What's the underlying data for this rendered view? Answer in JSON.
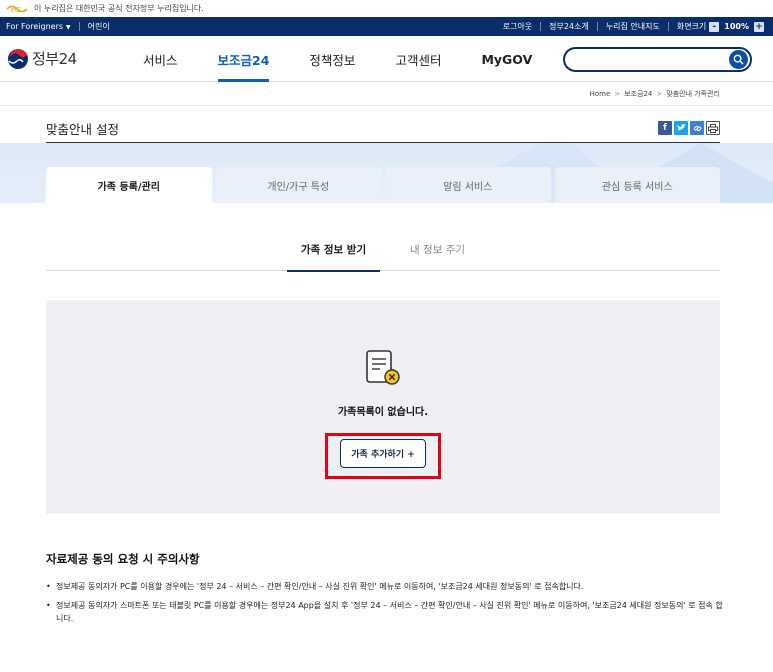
{
  "notice": {
    "text": "이 누리집은 대한민국 공식 전자정부 누리집입니다."
  },
  "utility": {
    "for_foreigners": "For Foreigners",
    "kids": "어린이",
    "logout": "로그아웃",
    "about": "정부24소개",
    "sitemap": "누리집 안내지도",
    "zoom_label": "화면크기",
    "zoom_minus": "-",
    "zoom_value": "100%",
    "zoom_plus": "+"
  },
  "header": {
    "brand": "정부24",
    "nav": [
      {
        "label": "서비스"
      },
      {
        "label": "보조금24"
      },
      {
        "label": "정책정보"
      },
      {
        "label": "고객센터"
      },
      {
        "label": "MyGOV"
      }
    ],
    "search_placeholder": ""
  },
  "breadcrumb": [
    "Home",
    "보조금24",
    "맞춤안내 가족관리"
  ],
  "page": {
    "title": "맞춤안내 설정"
  },
  "tabs": [
    {
      "label": "가족 등록/관리"
    },
    {
      "label": "개인/가구 특성"
    },
    {
      "label": "알림 서비스"
    },
    {
      "label": "관심 등록 서비스"
    }
  ],
  "subtabs": [
    {
      "label": "가족 정보 받기"
    },
    {
      "label": "내 정보 주기"
    }
  ],
  "empty_state": {
    "message": "가족목록이 없습니다.",
    "button": "가족 추가하기 +"
  },
  "notes": {
    "heading": "자료제공 동의 요청 시 주의사항",
    "items": [
      "정보제공 동의자가 PC를 이용할 경우에는 '정부 24 – 서비스 – 간편 확인/안내 – 사실 진위 확인' 메뉴로 이동하여, '보조금24 세대원 정보동의' 로 접속합니다.",
      "정보제공 동의자가 스마트폰 또는 태블릿 PC를 이용할 경우에는 정부24 App을 설치 후 '정부 24 – 서비스 – 간편 확인/안내 – 사실 진위 확인' 메뉴로 이동하여, '보조금24 세대원 정보동의' 로 접속 합니다."
    ]
  },
  "colors": {
    "navy": "#0b2d6b",
    "accent_blue": "#0e5fb8",
    "highlight_red": "#e8000f"
  }
}
